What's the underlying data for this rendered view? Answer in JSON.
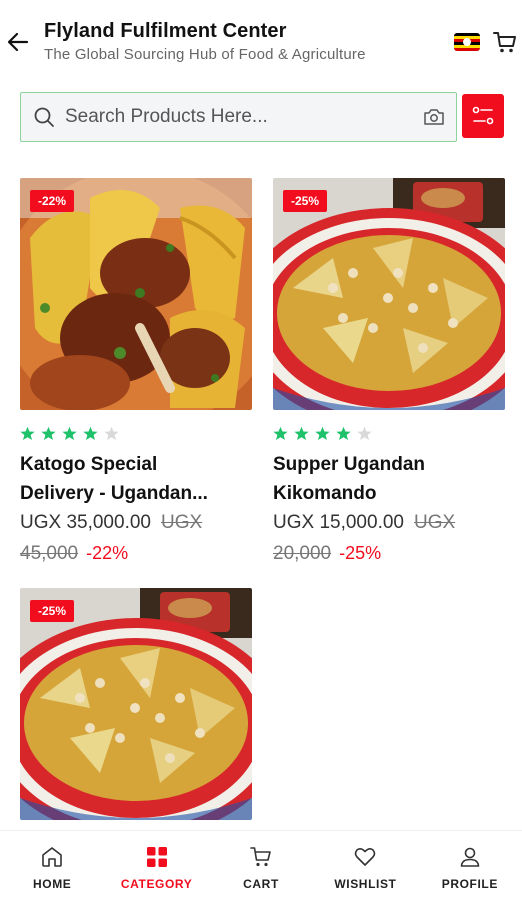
{
  "header": {
    "title": "Flyland Fulfilment Center",
    "subtitle": "The Global Sourcing Hub of Food & Agriculture",
    "flag": "uganda-flag"
  },
  "search": {
    "placeholder": "Search Products Here..."
  },
  "colors": {
    "accent": "#f20d1e",
    "star": "#1fc16b",
    "star_empty": "#d9d9d9",
    "search_border": "#8bd39b"
  },
  "products": [
    {
      "discount_badge": "-22%",
      "rating": 4,
      "rating_max": 5,
      "name_line1": "Katogo Special",
      "name_line2": "Delivery - Ugandan...",
      "price": "UGX 35,000.00",
      "old_price_part1": "UGX",
      "old_price_part2": "45,000",
      "discount": "-22%",
      "image": "matoke-beef-stew"
    },
    {
      "discount_badge": "-25%",
      "rating": 4,
      "rating_max": 5,
      "name_line1": "Supper Ugandan",
      "name_line2": "Kikomando",
      "price": "UGX 15,000.00",
      "old_price_part1": "UGX",
      "old_price_part2": "20,000",
      "discount": "-25%",
      "image": "beans-chapati-plate"
    },
    {
      "discount_badge": "-25%",
      "image": "beans-chapati-plate"
    }
  ],
  "nav": [
    {
      "label": "HOME",
      "icon": "home-icon"
    },
    {
      "label": "CATEGORY",
      "icon": "category-icon"
    },
    {
      "label": "CART",
      "icon": "cart-icon"
    },
    {
      "label": "WISHLIST",
      "icon": "heart-icon"
    },
    {
      "label": "PROFILE",
      "icon": "profile-icon"
    }
  ]
}
